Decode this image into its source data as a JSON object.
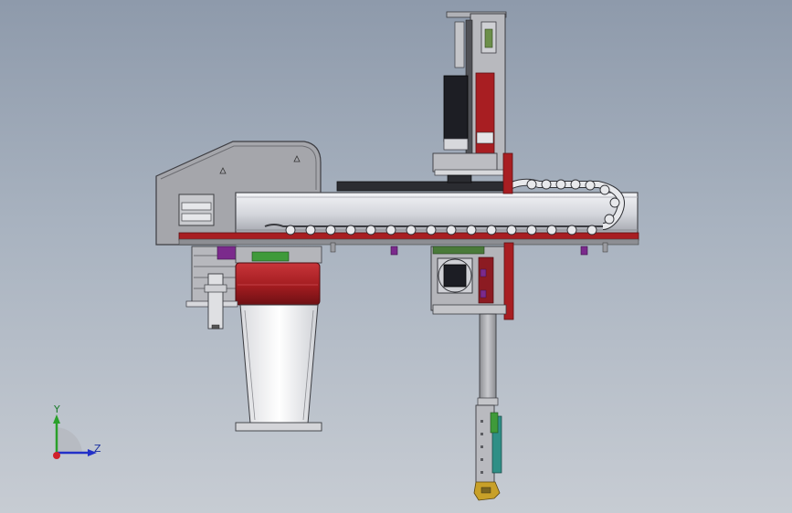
{
  "viewport": {
    "background_top": "#8e9aab",
    "background_bottom": "#c7ccd3"
  },
  "model": {
    "description_name": "gantry-robot-arm-assembly",
    "colors": {
      "frame_gray": "#a8a8ad",
      "frame_dark": "#5c5c62",
      "beam_light": "#dcdde2",
      "red_plate": "#a81e22",
      "purple_bolt": "#7b2a8c",
      "green_part": "#3f9a3a",
      "teal_part": "#2f8f86",
      "black_motor": "#1c1c22",
      "gold_part": "#c8a028"
    }
  },
  "triad": {
    "y_label": "Y",
    "z_label": "Z",
    "y_color": "#2aa02a",
    "z_color": "#2230c8",
    "x_color": "#d0202a"
  }
}
